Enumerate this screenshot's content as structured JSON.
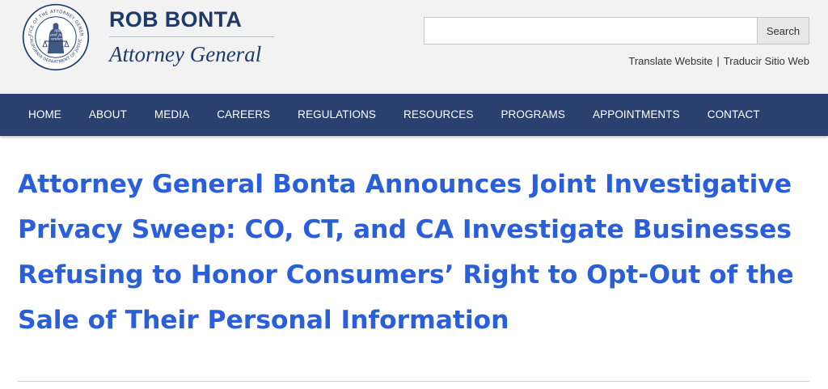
{
  "header": {
    "brand_name": "ROB BONTA",
    "brand_title": "Attorney General",
    "seal_texts": {
      "top": "OFFICE OF THE ATTORNEY GENERAL",
      "bottom": "CALIFORNIA DEPARTMENT OF JUSTICE",
      "motto": [
        "liberty",
        "and justice",
        "under law"
      ]
    },
    "search": {
      "placeholder": "",
      "button_label": "Search"
    },
    "translate": {
      "english": "Translate Website",
      "separator": "|",
      "spanish": "Traducir Sitio Web"
    }
  },
  "nav": {
    "items": [
      {
        "label": "HOME"
      },
      {
        "label": "ABOUT"
      },
      {
        "label": "MEDIA"
      },
      {
        "label": "CAREERS"
      },
      {
        "label": "REGULATIONS"
      },
      {
        "label": "RESOURCES"
      },
      {
        "label": "PROGRAMS"
      },
      {
        "label": "APPOINTMENTS"
      },
      {
        "label": "CONTACT"
      }
    ]
  },
  "article": {
    "headline": "Attorney General Bonta Announces Joint Investigative Privacy Sweep: CO, CT, and CA Investigate Businesses Refusing to Honor Consumers’ Right to Opt-Out of the Sale of Their Personal Information"
  },
  "colors": {
    "brand": "#1e3a6b",
    "nav_background": "#2a4170",
    "headline": "#2b5fd9",
    "header_background": "#f2f2f2"
  }
}
